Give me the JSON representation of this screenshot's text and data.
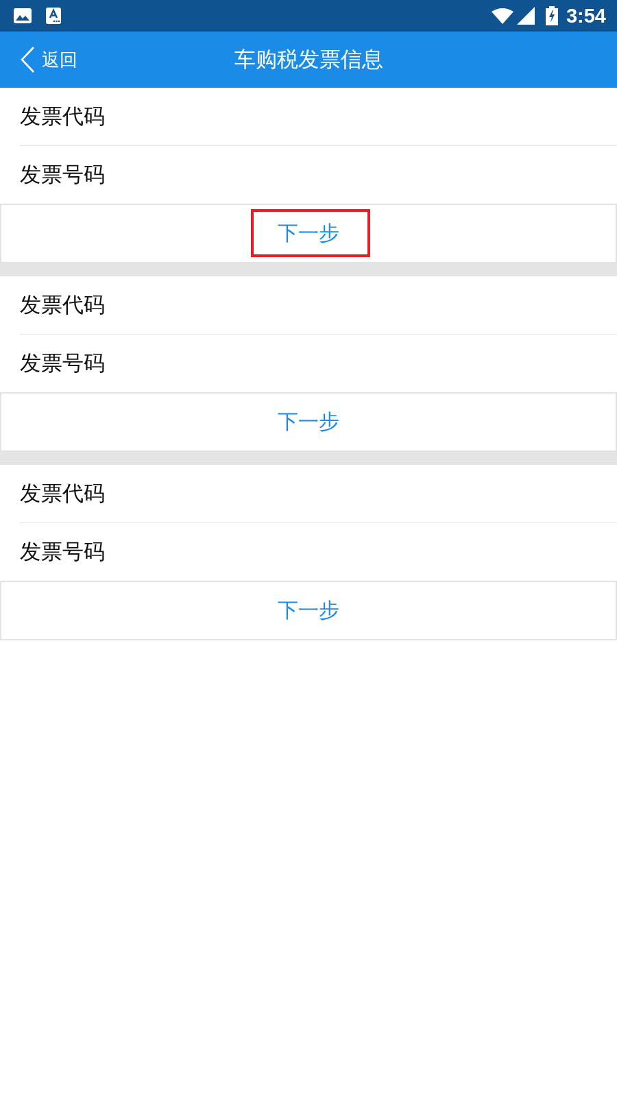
{
  "status_bar": {
    "time": "3:54"
  },
  "header": {
    "back_label": "返回",
    "title": "车购税发票信息"
  },
  "sections": [
    {
      "fields": [
        {
          "label": "发票代码"
        },
        {
          "label": "发票号码"
        }
      ],
      "next_button": {
        "label": "下一步",
        "highlighted": true
      }
    },
    {
      "fields": [
        {
          "label": "发票代码"
        },
        {
          "label": "发票号码"
        }
      ],
      "next_button": {
        "label": "下一步",
        "highlighted": false
      }
    },
    {
      "fields": [
        {
          "label": "发票代码"
        },
        {
          "label": "发票号码"
        }
      ],
      "next_button": {
        "label": "下一步",
        "highlighted": false
      }
    }
  ]
}
